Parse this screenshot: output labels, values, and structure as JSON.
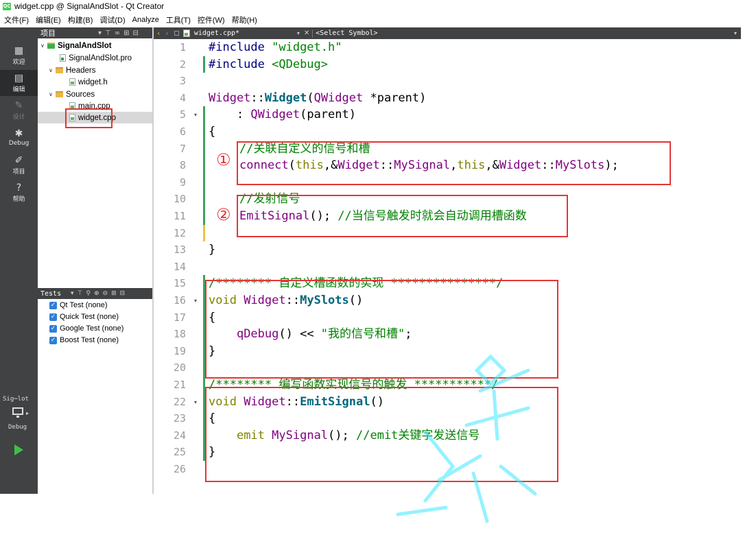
{
  "window": {
    "title": "widget.cpp @ SignalAndSlot - Qt Creator",
    "app_icon_text": "QC"
  },
  "menubar": {
    "items": [
      "文件(F)",
      "编辑(E)",
      "构建(B)",
      "调试(D)",
      "Analyze",
      "工具(T)",
      "控件(W)",
      "帮助(H)"
    ]
  },
  "modes": {
    "welcome": {
      "label": "欢迎",
      "icon": "grid-icon"
    },
    "edit": {
      "label": "编辑",
      "icon": "edit-doc-icon"
    },
    "design": {
      "label": "设计",
      "icon": "pencil-icon"
    },
    "debug": {
      "label": "Debug",
      "icon": "bug-icon"
    },
    "projects": {
      "label": "项目",
      "icon": "wrench-icon"
    },
    "help": {
      "label": "帮助",
      "icon": "question-icon"
    },
    "kit_label": "Sig⋯lot",
    "kit_build": "Debug"
  },
  "project_panel": {
    "title": "项目",
    "tree": [
      {
        "label": "SignalAndSlot",
        "type": "project",
        "bold": true
      },
      {
        "label": "SignalAndSlot.pro",
        "type": "pro-file"
      },
      {
        "label": "Headers",
        "type": "folder"
      },
      {
        "label": "widget.h",
        "type": "header-file"
      },
      {
        "label": "Sources",
        "type": "folder"
      },
      {
        "label": "main.cpp",
        "type": "source-file"
      },
      {
        "label": "widget.cpp",
        "type": "source-file",
        "selected": true
      }
    ]
  },
  "tests_panel": {
    "title": "Tests",
    "items": [
      {
        "label": "Qt Test (none)",
        "checked": true
      },
      {
        "label": "Quick Test (none)",
        "checked": true
      },
      {
        "label": "Google Test (none)",
        "checked": true
      },
      {
        "label": "Boost Test (none)",
        "checked": true
      }
    ]
  },
  "editor": {
    "document": "widget.cpp*",
    "symbol": "<Select Symbol>",
    "line_numbers": [
      "1",
      "2",
      "3",
      "4",
      "5",
      "6",
      "7",
      "8",
      "9",
      "10",
      "11",
      "12",
      "13",
      "14",
      "15",
      "16",
      "17",
      "18",
      "19",
      "20",
      "21",
      "22",
      "23",
      "24",
      "25",
      "26"
    ],
    "lines": [
      "#include \"widget.h\"",
      "#include <QDebug>",
      "",
      "Widget::Widget(QWidget *parent)",
      "    : QWidget(parent)",
      "{",
      "//关联自定义的信号和槽",
      "connect(this,&Widget::MySignal,this,&Widget::MySlots);",
      "",
      "//发射信号",
      "EmitSignal(); //当信号触发时就会自动调用槽函数",
      "",
      "}",
      "",
      "/******** 自定义槽函数的实现 ***************/",
      "void Widget::MySlots()",
      "{",
      "    qDebug() << \"我的信号和槽\";",
      "}",
      "",
      "/******** 编写函数实现信号的触发 ***********/",
      "void Widget::EmitSignal()",
      "{",
      "    emit MySignal(); //emit关键字发送信号",
      "}",
      ""
    ]
  },
  "annotations": {
    "marker_1": "①",
    "marker_2": "②"
  },
  "colors": {
    "annotation_red": "#e53535",
    "keyword_purple": "#800080",
    "comment_green": "#008000",
    "function_teal": "#00677c"
  }
}
